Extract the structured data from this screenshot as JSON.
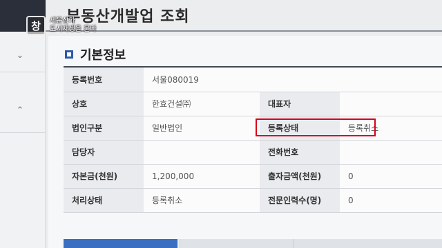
{
  "page": {
    "title": "부동산개발업 조회"
  },
  "overlay": {
    "logo_glyph": "창",
    "caption_line1": "세운상가",
    "caption_line2": "도시재생을 묻다"
  },
  "sidebar": {
    "icons": [
      "chevron-down-icon",
      "chevron-up-icon"
    ]
  },
  "section": {
    "title": "기본정보"
  },
  "table": {
    "rows": [
      {
        "l1": "등록번호",
        "v1": "서울080019",
        "l2": "",
        "v2": ""
      },
      {
        "l1": "상호",
        "v1": "한효건설㈜",
        "l2": "대표자",
        "v2": ""
      },
      {
        "l1": "법인구분",
        "v1": "일반법인",
        "l2": "등록상태",
        "v2": "등록취소"
      },
      {
        "l1": "담당자",
        "v1": "",
        "l2": "전화번호",
        "v2": ""
      },
      {
        "l1": "자본금(천원)",
        "v1": "1,200,000",
        "l2": "출자금액(천원)",
        "v2": "0"
      },
      {
        "l1": "처리상태",
        "v1": "등록취소",
        "l2": "전문인력수(명)",
        "v2": "0"
      }
    ]
  },
  "colors": {
    "highlight": "#d6001c",
    "accent": "#2b5aa8",
    "active_tab": "#3a6fc2"
  }
}
